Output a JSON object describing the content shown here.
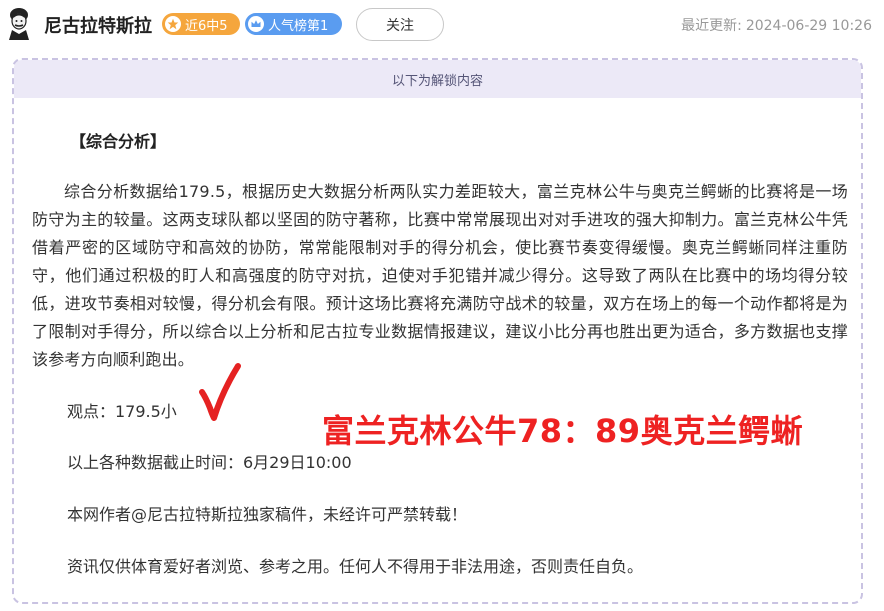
{
  "header": {
    "author_name": "尼古拉特斯拉",
    "streak_badge": "近6中5",
    "rank_badge": "人气榜第1",
    "follow_label": "关注",
    "update_label": "最近更新:",
    "update_time": "2024-06-29 10:26"
  },
  "card": {
    "unlock_notice": "以下为解锁内容",
    "section_title": "【综合分析】",
    "analysis_paragraph": "综合分析数据给179.5，根据历史大数据分析两队实力差距较大，富兰克林公牛与奥克兰鳄蜥的比赛将是一场防守为主的较量。这两支球队都以坚固的防守著称，比赛中常常展现出对对手进攻的强大抑制力。富兰克林公牛凭借着严密的区域防守和高效的协防，常常能限制对手的得分机会，使比赛节奏变得缓慢。奥克兰鳄蜥同样注重防守，他们通过积极的盯人和高强度的防守对抗，迫使对手犯错并减少得分。这导致了两队在比赛中的场均得分较低，进攻节奏相对较慢，得分机会有限。预计这场比赛将充满防守战术的较量，双方在场上的每一个动作都将是为了限制对手得分，所以综合以上分析和尼古拉专业数据情报建议，建议小比分再也胜出更为适合，多方数据也支撑该参考方向顺利跑出。",
    "opinion": "观点：179.5小",
    "final_score": "富兰克林公牛78：89奥克兰鳄蜥",
    "data_cutoff": "以上各种数据截止时间：6月29日10:00",
    "copyright_notice": "本网作者@尼古拉特斯拉独家稿件，未经许可严禁转载！",
    "disclaimer": "资讯仅供体育爱好者浏览、参考之用。任何人不得用于非法用途，否则责任自负。"
  },
  "colors": {
    "streak_badge_bg": "#f5a63d",
    "rank_badge_bg": "#5a9cf0",
    "check_mark": "#e52222",
    "score_text": "#ee2222",
    "card_border": "#c9c3e2",
    "unlock_bar_bg": "#ece9f7"
  },
  "icons": {
    "avatar": "tesla-portrait-icon",
    "streak": "star-icon",
    "rank": "crown-icon",
    "check": "check-mark-icon"
  }
}
